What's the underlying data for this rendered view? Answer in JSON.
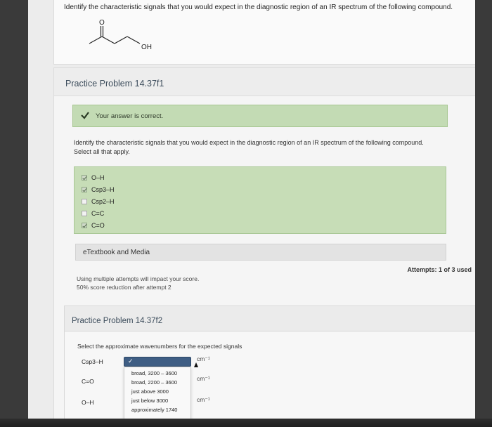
{
  "question": "Identify the characteristic signals that you would expect in the diagnostic region of an IR spectrum of the following compound.",
  "molecule": {
    "label_O": "O",
    "label_OH": "OH"
  },
  "problem1": {
    "title": "Practice Problem 14.37f1",
    "correct_message": "Your answer is correct.",
    "instruction_line1": "Identify the characteristic signals that you would expect in the diagnostic region of an IR spectrum of the following compound.",
    "instruction_line2": "Select all that apply.",
    "options": [
      {
        "label": "O–H",
        "checked": true
      },
      {
        "label": "Csp3–H",
        "checked": true
      },
      {
        "label": "Csp2–H",
        "checked": false
      },
      {
        "label": "C=C",
        "checked": false
      },
      {
        "label": "C=O",
        "checked": true
      }
    ],
    "etextbook": "eTextbook and Media",
    "attempts": "Attempts: 1 of 3 used",
    "warn_line1": "Using multiple attempts will impact your score.",
    "warn_line2": "50% score reduction after attempt 2"
  },
  "problem2": {
    "title": "Practice Problem 14.37f2",
    "instruction": "Select the approximate wavenumbers for the expected signals",
    "rows": [
      {
        "label": "Csp3–H",
        "unit": "cm⁻¹"
      },
      {
        "label": "C=O",
        "unit": "cm⁻¹"
      },
      {
        "label": "O–H",
        "unit": "cm⁻¹"
      }
    ],
    "dropdown": {
      "selected_glyph": "✓",
      "options": [
        "broad, 3200 – 3600",
        "broad, 2200 – 3600",
        "just above 3000",
        "just below 3000",
        "approximately 1740"
      ]
    }
  },
  "colors": {
    "correct_bg": "#c3dbb4",
    "dropdown_selected": "#3f5e84"
  }
}
